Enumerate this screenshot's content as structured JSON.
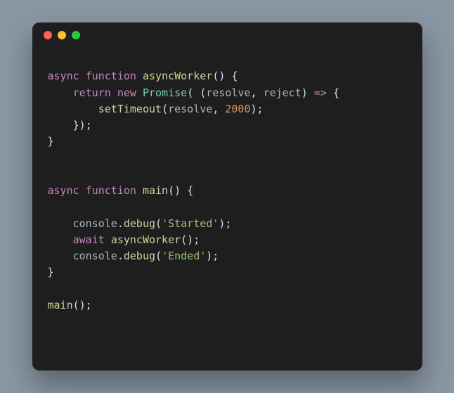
{
  "window": {
    "dots": {
      "close": "#ff5f56",
      "minimize": "#ffbd2e",
      "zoom": "#27c93f"
    },
    "bg": "#1e1e1e"
  },
  "code": {
    "tokens": [
      [
        [
          "",
          ""
        ]
      ],
      [
        [
          "kw",
          "async"
        ],
        [
          "pun",
          " "
        ],
        [
          "kw",
          "function"
        ],
        [
          "pun",
          " "
        ],
        [
          "fn",
          "asyncWorker"
        ],
        [
          "pun",
          "() {"
        ]
      ],
      [
        [
          "pun",
          "    "
        ],
        [
          "kw",
          "return"
        ],
        [
          "pun",
          " "
        ],
        [
          "kw",
          "new"
        ],
        [
          "pun",
          " "
        ],
        [
          "cls",
          "Promise"
        ],
        [
          "pun",
          "( ("
        ],
        [
          "var",
          "resolve"
        ],
        [
          "pun",
          ", "
        ],
        [
          "var",
          "reject"
        ],
        [
          "pun",
          ") "
        ],
        [
          "kw",
          "=>"
        ],
        [
          "pun",
          " {"
        ]
      ],
      [
        [
          "pun",
          "        "
        ],
        [
          "fn",
          "setTimeout"
        ],
        [
          "pun",
          "("
        ],
        [
          "var",
          "resolve"
        ],
        [
          "pun",
          ", "
        ],
        [
          "num",
          "2000"
        ],
        [
          "pun",
          ");"
        ]
      ],
      [
        [
          "pun",
          "    });"
        ]
      ],
      [
        [
          "pun",
          "}"
        ]
      ],
      [
        [
          "",
          ""
        ]
      ],
      [
        [
          "",
          ""
        ]
      ],
      [
        [
          "kw",
          "async"
        ],
        [
          "pun",
          " "
        ],
        [
          "kw",
          "function"
        ],
        [
          "pun",
          " "
        ],
        [
          "fn",
          "main"
        ],
        [
          "pun",
          "() {"
        ]
      ],
      [
        [
          "",
          ""
        ]
      ],
      [
        [
          "pun",
          "    "
        ],
        [
          "var",
          "console"
        ],
        [
          "pun",
          "."
        ],
        [
          "prop",
          "debug"
        ],
        [
          "pun",
          "("
        ],
        [
          "str",
          "'Started'"
        ],
        [
          "pun",
          ");"
        ]
      ],
      [
        [
          "pun",
          "    "
        ],
        [
          "kw",
          "await"
        ],
        [
          "pun",
          " "
        ],
        [
          "fn",
          "asyncWorker"
        ],
        [
          "pun",
          "();"
        ]
      ],
      [
        [
          "pun",
          "    "
        ],
        [
          "var",
          "console"
        ],
        [
          "pun",
          "."
        ],
        [
          "prop",
          "debug"
        ],
        [
          "pun",
          "("
        ],
        [
          "str",
          "'Ended'"
        ],
        [
          "pun",
          ");"
        ]
      ],
      [
        [
          "pun",
          "}"
        ]
      ],
      [
        [
          "",
          ""
        ]
      ],
      [
        [
          "fn",
          "main"
        ],
        [
          "pun",
          "();"
        ]
      ]
    ]
  }
}
